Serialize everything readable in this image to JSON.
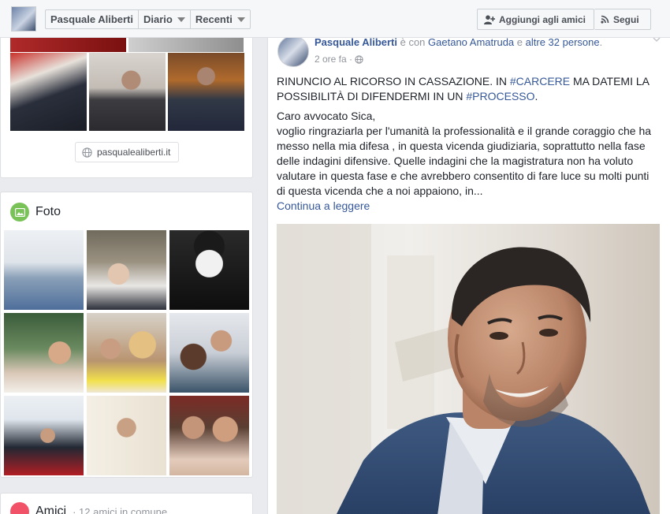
{
  "topbar": {
    "profile_name": "Pasquale Aliberti",
    "nav_diary": "Diario",
    "nav_recent": "Recenti",
    "add_friend_label": "Aggiungi agli amici",
    "follow_label": "Segui"
  },
  "intro": {
    "website": "pasqualealiberti.it"
  },
  "photos": {
    "title": "Foto"
  },
  "friends": {
    "title": "Amici",
    "subtitle": " · 12 amici in comune"
  },
  "post": {
    "author": "Pasquale Aliberti",
    "with_word": " è con ",
    "tagged_friend": "Gaetano Amatruda",
    "and_word": " e ",
    "others": "altre 32 persone",
    "time": "2 ore fa ·",
    "headline_a": "RINUNCIO AL RICORSO IN CASSAZIONE. IN ",
    "hashtag_1": "#CARCERE",
    "headline_b": " MA DATEMI LA POSSIBILITÀ DI DIFENDERMI IN UN ",
    "hashtag_2": "#PROCESSO",
    "headline_c": ".",
    "salutation": "Caro avvocato Sica,",
    "body": "voglio ringraziarla per l'umanità la professionalità e il grande coraggio che ha messo nella mia difesa , in questa vicenda giudiziaria, soprattutto nella fase delle indagini difensive. Quelle indagini che la magistratura non ha voluto valutare in questa fase e che avrebbero consentito di fare luce su molti punti di questa vicenda che a noi appaiono, in...",
    "read_more": "Continua a leggere"
  },
  "colors": {
    "link": "#365899",
    "photos_icon": "#78c257",
    "friends_icon": "#f25268"
  }
}
